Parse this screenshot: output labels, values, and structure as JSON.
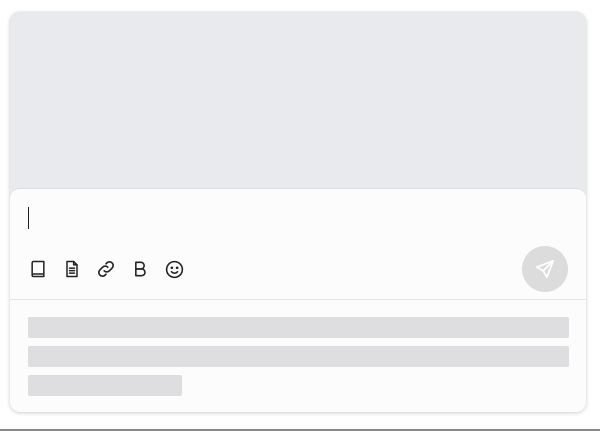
{
  "composer": {
    "input": {
      "value": "",
      "placeholder": ""
    },
    "toolbar": [
      {
        "icon": "book-icon"
      },
      {
        "icon": "document-icon"
      },
      {
        "icon": "link-icon"
      },
      {
        "icon": "bold-icon",
        "glyph": "B"
      },
      {
        "icon": "emoji-icon"
      }
    ],
    "send": {
      "icon": "send-icon",
      "state": "disabled"
    }
  },
  "skeleton": {
    "line_count": 3
  },
  "colors": {
    "card_background": "#e9eaee",
    "composer_background": "#fdfcfd",
    "send_button_disabled": "#dcdcdd",
    "skeleton": "#dedee0"
  }
}
